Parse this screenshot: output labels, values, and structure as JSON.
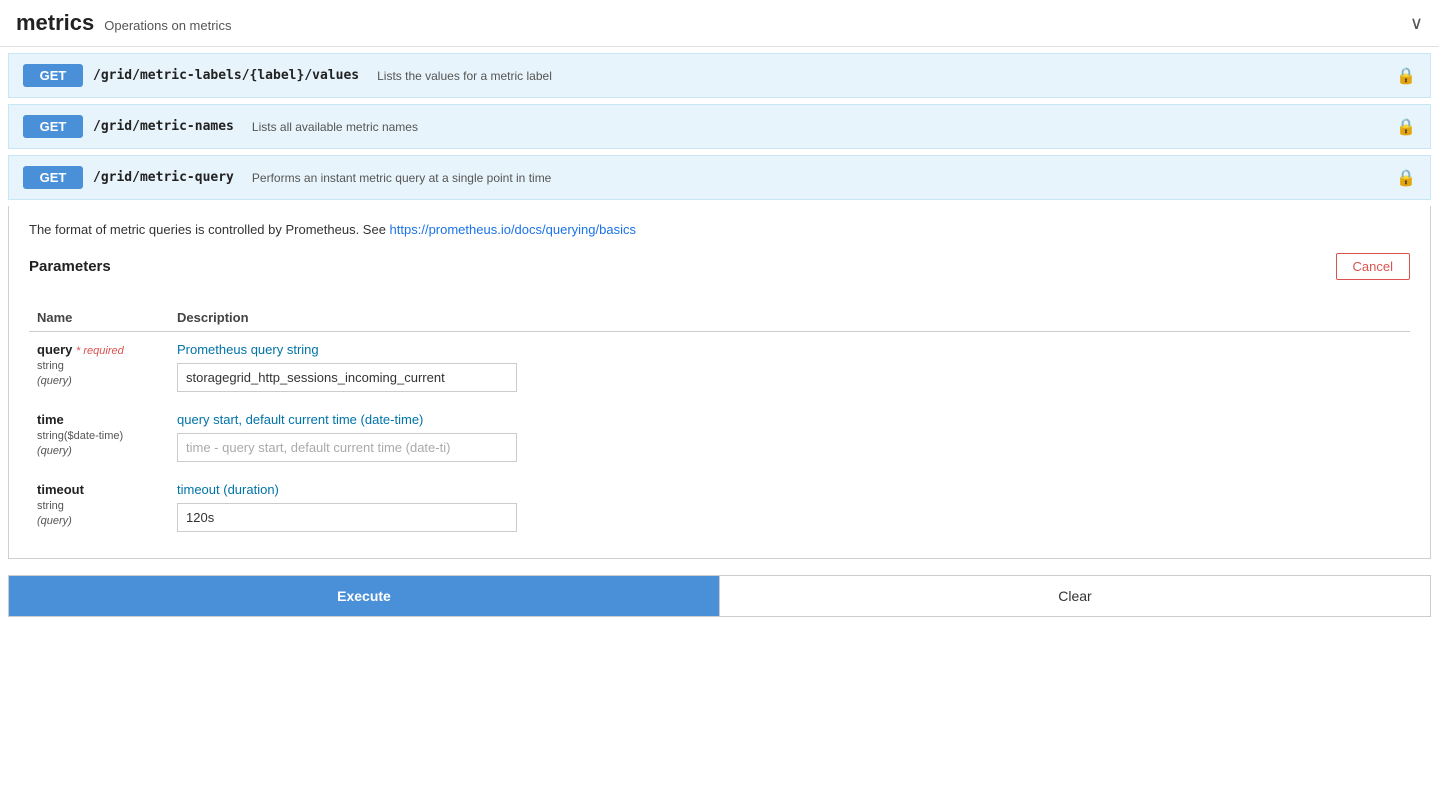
{
  "header": {
    "title": "metrics",
    "subtitle": "Operations on metrics",
    "chevron": "∨"
  },
  "api_rows": [
    {
      "method": "GET",
      "path": "/grid/metric-labels/{label}/values",
      "description": "Lists the values for a metric label"
    },
    {
      "method": "GET",
      "path": "/grid/metric-names",
      "description": "Lists all available metric names"
    },
    {
      "method": "GET",
      "path": "/grid/metric-query",
      "description": "Performs an instant metric query at a single point in time"
    }
  ],
  "expanded": {
    "prometheus_note": "The format of metric queries is controlled by Prometheus. See ",
    "prometheus_link_text": "https://prometheus.io/docs/querying/basics",
    "prometheus_link_href": "https://prometheus.io/docs/querying/basics",
    "parameters_label": "Parameters",
    "cancel_label": "Cancel",
    "columns": {
      "name": "Name",
      "description": "Description"
    },
    "params": [
      {
        "name": "query",
        "required": "* required",
        "type": "string",
        "location": "(query)",
        "description": "Prometheus query string",
        "value": "storagegrid_http_sessions_incoming_current",
        "placeholder": ""
      },
      {
        "name": "time",
        "required": "",
        "type": "string($date-time)",
        "location": "(query)",
        "description": "query start, default current time (date-time)",
        "value": "",
        "placeholder": "time - query start, default current time (date-ti"
      },
      {
        "name": "timeout",
        "required": "",
        "type": "string",
        "location": "(query)",
        "description": "timeout (duration)",
        "value": "120s",
        "placeholder": ""
      }
    ],
    "execute_label": "Execute",
    "clear_label": "Clear"
  }
}
